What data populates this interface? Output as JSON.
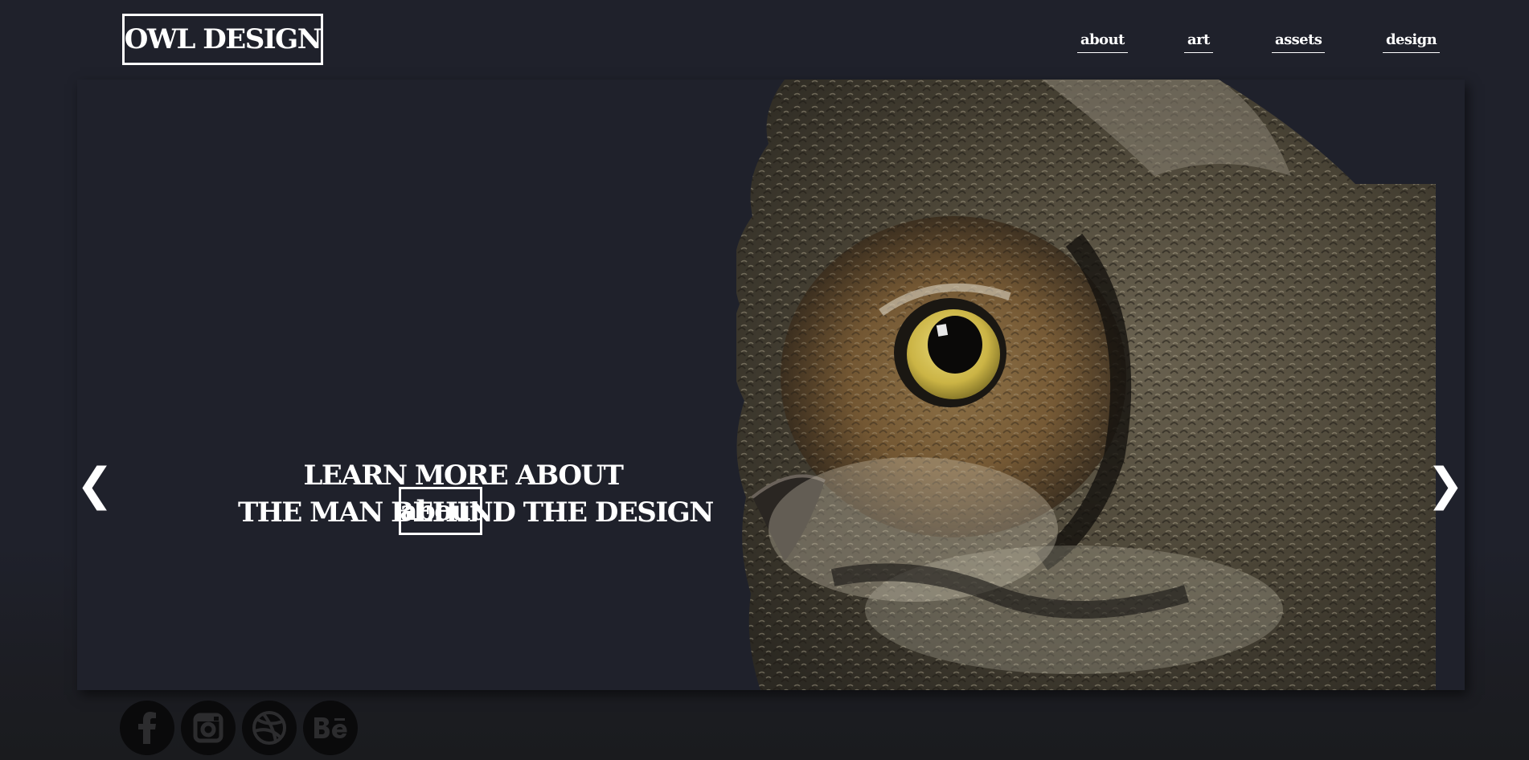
{
  "brand": {
    "logo_text": "OWL DESIGN"
  },
  "nav": {
    "items": [
      {
        "label": "about"
      },
      {
        "label": "art"
      },
      {
        "label": "assets"
      },
      {
        "label": "design"
      }
    ]
  },
  "hero": {
    "headline_line1": "LEARN MORE ABOUT",
    "headline_line2": "THE MAN BEHIND THE DESIGN",
    "cta_label": "about",
    "prev_arrow": "❮",
    "next_arrow": "❯",
    "image_subject": "great horned owl close-up"
  },
  "social": {
    "items": [
      {
        "icon": "facebook-icon"
      },
      {
        "icon": "instagram-icon"
      },
      {
        "icon": "dribbble-icon"
      },
      {
        "icon": "behance-icon"
      }
    ]
  },
  "colors": {
    "background": "#1f212b",
    "text": "#ffffff",
    "owl_eye": "#d6c150"
  }
}
